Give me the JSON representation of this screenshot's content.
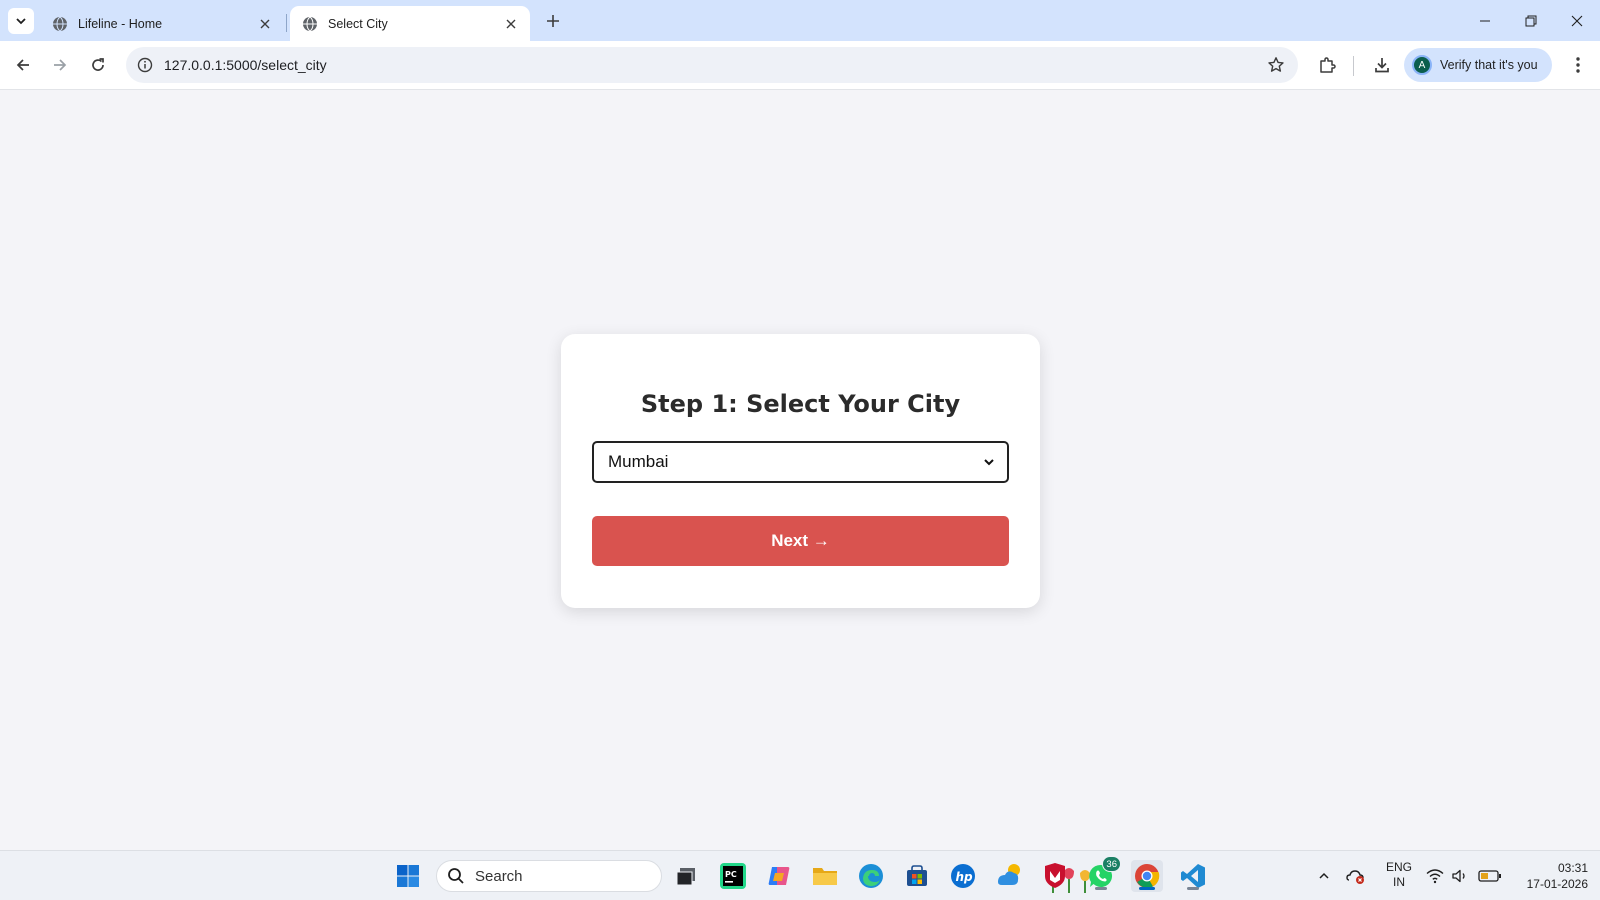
{
  "browser": {
    "tabs": [
      {
        "title": "Lifeline - Home",
        "active": false
      },
      {
        "title": "Select City",
        "active": true
      }
    ],
    "url": "127.0.0.1:5000/select_city",
    "profile_chip": {
      "avatar_letter": "A",
      "label": "Verify that it's you"
    }
  },
  "page": {
    "title": "Step 1: Select Your City",
    "city_select": {
      "selected": "Mumbai"
    },
    "next_button": {
      "label": "Next →"
    },
    "colors": {
      "accent": "#d9534f",
      "background": "#f4f4f8"
    }
  },
  "taskbar": {
    "search_label": "Search",
    "whatsapp_badge": "36",
    "language": {
      "line1": "ENG",
      "line2": "IN"
    },
    "clock": {
      "time": "03:31",
      "date": "17-01-2026"
    }
  }
}
